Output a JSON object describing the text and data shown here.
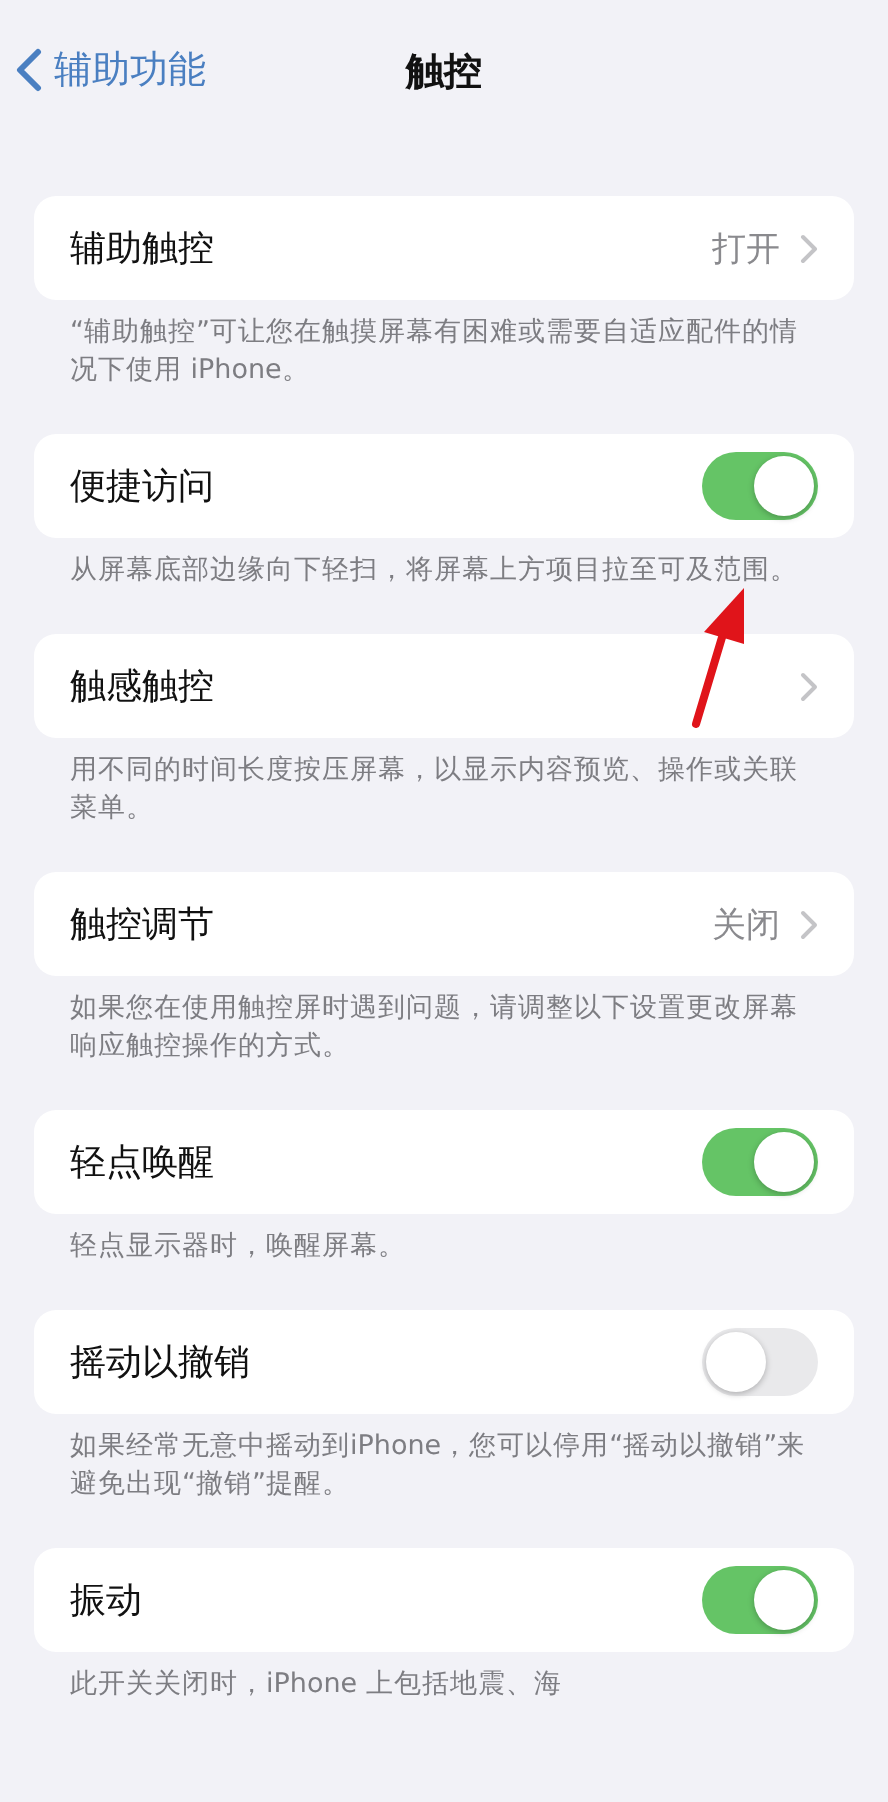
{
  "nav": {
    "back_label": "辅助功能",
    "title": "触控"
  },
  "sections": [
    {
      "kind": "link",
      "label": "辅助触控",
      "value": "打开",
      "footer": "“辅助触控”可让您在触摸屏幕有困难或需要自适应配件的情况下使用 iPhone。"
    },
    {
      "kind": "toggle",
      "label": "便捷访问",
      "on": true,
      "footer": "从屏幕底部边缘向下轻扫，将屏幕上方项目拉至可及范围。"
    },
    {
      "kind": "link",
      "label": "触感触控",
      "footer": "用不同的时间长度按压屏幕，以显示内容预览、操作或关联菜单。"
    },
    {
      "kind": "link",
      "label": "触控调节",
      "value": "关闭",
      "footer": "如果您在使用触控屏时遇到问题，请调整以下设置更改屏幕响应触控操作的方式。"
    },
    {
      "kind": "toggle",
      "label": "轻点唤醒",
      "on": true,
      "footer": "轻点显示器时，唤醒屏幕。"
    },
    {
      "kind": "toggle",
      "label": "摇动以撤销",
      "on": false,
      "footer": "如果经常无意中摇动到iPhone，您可以停用“摇动以撤销”来避免出现“撤销”提醒。"
    },
    {
      "kind": "toggle",
      "label": "振动",
      "on": true,
      "footer": "此开关关闭时，iPhone 上包括地震、海"
    }
  ]
}
